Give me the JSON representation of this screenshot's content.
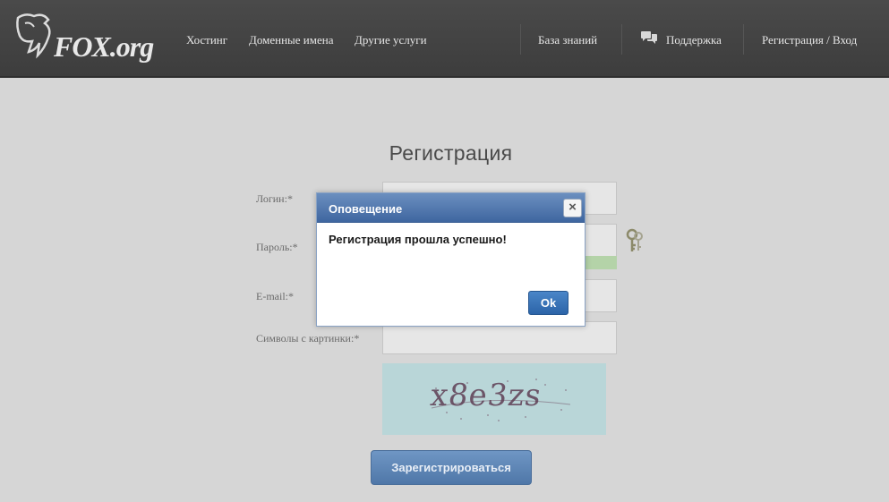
{
  "header": {
    "logo_text": "FOX.org",
    "nav": {
      "hosting": "Хостинг",
      "domains": "Доменные имена",
      "other": "Другие услуги",
      "kb": "База знаний",
      "support": "Поддержка",
      "auth": "Регистрация / Вход"
    },
    "icons": {
      "support": "chat-bubbles-icon"
    }
  },
  "form": {
    "title": "Регистрация",
    "login_label": "Логин:*",
    "password_label": "Пароль:*",
    "email_label": "E-mail:*",
    "captcha_label": "Символы с картинки:*",
    "captcha_text": "x8e3zs",
    "submit_label": "Зарегистрироваться",
    "icons": {
      "password": "key-icon"
    }
  },
  "dialog": {
    "title": "Оповещение",
    "close_label": "×",
    "message": "Регистрация прошла успешно!",
    "ok_label": "Ok"
  },
  "colors": {
    "header_bg": "#444444",
    "dialog_header": "#4a70a8",
    "button_primary": "#5b82b4",
    "page_bg": "#d6d6d6"
  }
}
